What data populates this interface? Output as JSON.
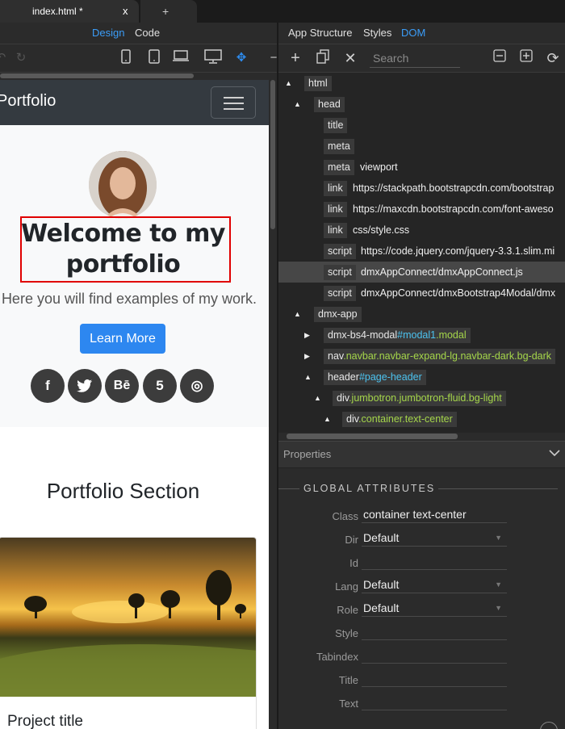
{
  "tabs": {
    "active_label": "index.html *",
    "close_label": "x",
    "new_label": "+"
  },
  "view_switch": {
    "design": "Design",
    "code": "Code"
  },
  "page": {
    "brand": "Portfolio",
    "heading": "Welcome to my portfolio",
    "lead": "Here you will find examples of my work.",
    "button": "Learn More",
    "social": [
      "f",
      "t",
      "Bē",
      "5",
      "◎"
    ],
    "section_title": "Portfolio Section",
    "card_title": "Project title"
  },
  "right_tabs": {
    "app_structure": "App Structure",
    "styles": "Styles",
    "dom": "DOM"
  },
  "search": {
    "placeholder": "Search"
  },
  "tree": [
    {
      "tag": "html",
      "id": "",
      "cls": "",
      "value": "",
      "arrow": "▲"
    },
    {
      "tag": "head",
      "id": "",
      "cls": "",
      "value": "",
      "arrow": "▲"
    },
    {
      "tag": "title",
      "id": "",
      "cls": "",
      "value": "",
      "arrow": ""
    },
    {
      "tag": "meta",
      "id": "",
      "cls": "",
      "value": "",
      "arrow": ""
    },
    {
      "tag": "meta",
      "id": "",
      "cls": "",
      "value": "viewport",
      "arrow": ""
    },
    {
      "tag": "link",
      "id": "",
      "cls": "",
      "value": "https://stackpath.bootstrapcdn.com/bootstrap",
      "arrow": ""
    },
    {
      "tag": "link",
      "id": "",
      "cls": "",
      "value": "https://maxcdn.bootstrapcdn.com/font-aweso",
      "arrow": ""
    },
    {
      "tag": "link",
      "id": "",
      "cls": "",
      "value": "css/style.css",
      "arrow": ""
    },
    {
      "tag": "script",
      "id": "",
      "cls": "",
      "value": "https://code.jquery.com/jquery-3.3.1.slim.mi",
      "arrow": ""
    },
    {
      "tag": "script",
      "id": "",
      "cls": "",
      "value": "dmxAppConnect/dmxAppConnect.js",
      "arrow": ""
    },
    {
      "tag": "script",
      "id": "",
      "cls": "",
      "value": "dmxAppConnect/dmxBootstrap4Modal/dmx",
      "arrow": ""
    },
    {
      "tag": "dmx-app",
      "id": "",
      "cls": "",
      "value": "",
      "arrow": "▲"
    },
    {
      "tag": "dmx-bs4-modal",
      "id": "#modal1",
      "cls": ".modal",
      "value": "",
      "arrow": "▶"
    },
    {
      "tag": "nav",
      "id": "",
      "cls": ".navbar.navbar-expand-lg.navbar-dark.bg-dark",
      "value": "",
      "arrow": "▶"
    },
    {
      "tag": "header",
      "id": "#page-header",
      "cls": "",
      "value": "",
      "arrow": "▲"
    },
    {
      "tag": "div",
      "id": "",
      "cls": ".jumbotron.jumbotron-fluid.bg-light",
      "value": "",
      "arrow": "▲"
    },
    {
      "tag": "div",
      "id": "",
      "cls": ".container.text-center",
      "value": "",
      "arrow": "▲"
    }
  ],
  "properties": {
    "header": "Properties",
    "section": "GLOBAL ATTRIBUTES",
    "rows": [
      {
        "label": "Class",
        "value": "container text-center",
        "dropdown": false
      },
      {
        "label": "Dir",
        "value": "Default",
        "dropdown": true
      },
      {
        "label": "Id",
        "value": "",
        "dropdown": false
      },
      {
        "label": "Lang",
        "value": "Default",
        "dropdown": true
      },
      {
        "label": "Role",
        "value": "Default",
        "dropdown": true
      },
      {
        "label": "Style",
        "value": "",
        "dropdown": false
      },
      {
        "label": "Tabindex",
        "value": "",
        "dropdown": false
      },
      {
        "label": "Title",
        "value": "",
        "dropdown": false
      },
      {
        "label": "Text",
        "value": "",
        "dropdown": false
      }
    ]
  }
}
